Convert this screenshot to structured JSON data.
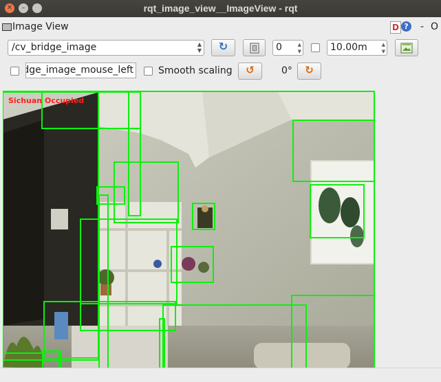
{
  "window": {
    "title": "rqt_image_view__ImageView - rqt"
  },
  "dock": {
    "title": "Image View",
    "help_d": "D",
    "help_q": "?",
    "minimize": "-",
    "close": "O"
  },
  "toolbar": {
    "topic": "/cv_bridge_image",
    "zoom_value": "0",
    "max_range": "10.00m",
    "mouse_topic": "dge_image_mouse_left",
    "smooth_scaling_label": "Smooth scaling",
    "rotation": "0°",
    "smooth_scaling_checked": false,
    "mouse_publish_checked": false,
    "max_range_checked": false
  },
  "image": {
    "overlay_text": "Sichuan Occupied",
    "overlay_color": "#ff2020",
    "box_color": "#0cf00c",
    "detections": 21
  }
}
